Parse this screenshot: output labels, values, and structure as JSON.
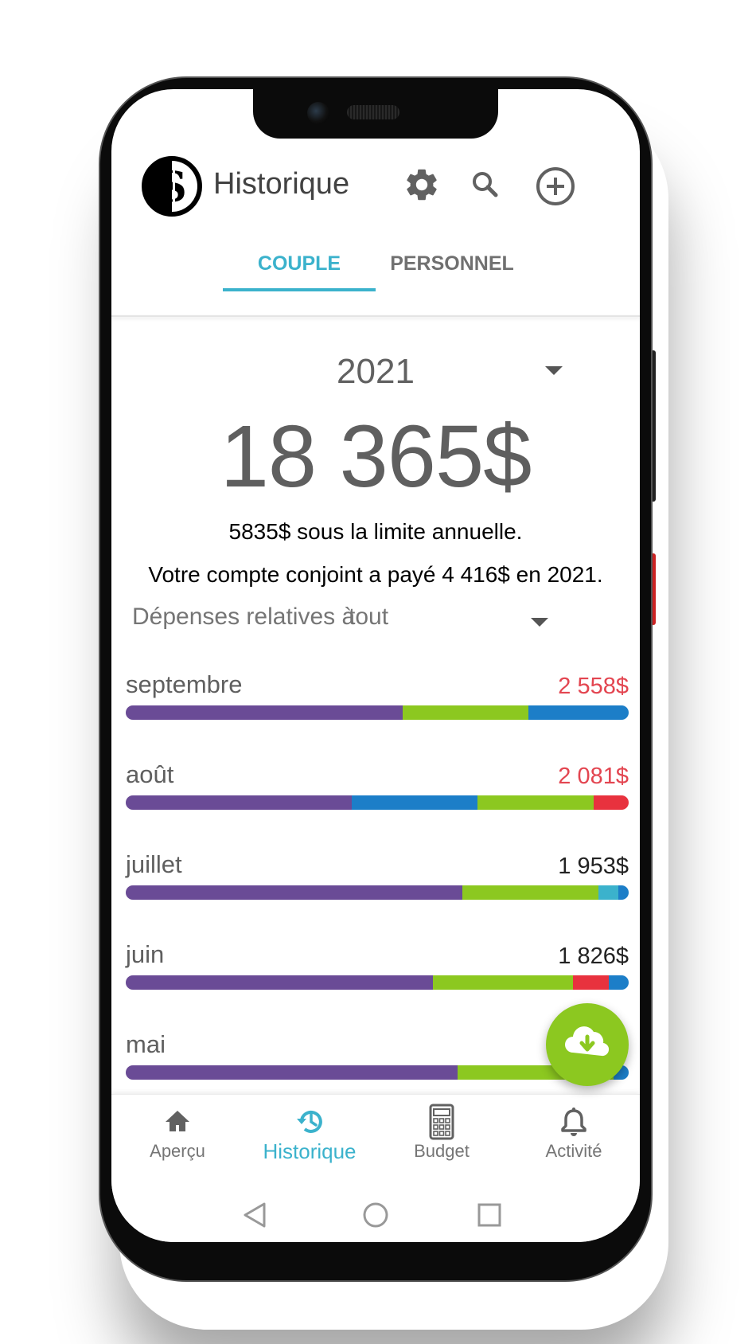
{
  "header": {
    "title": "Historique"
  },
  "tabs": [
    {
      "label": "COUPLE",
      "active": true
    },
    {
      "label": "PERSONNEL",
      "active": false
    }
  ],
  "summary": {
    "year": "2021",
    "total": "18 365$",
    "limit_text": "5835$ sous la limite annuelle.",
    "joint_text": "Votre compte conjoint a payé 4 416$ en 2021."
  },
  "filter": {
    "label": "Dépenses relatives à",
    "value": "tout"
  },
  "colors": {
    "accent": "#3bb2cc",
    "over_budget": "#e34550",
    "fab": "#8cc820",
    "purple": "#6a4b96",
    "green": "#8cc820",
    "blue": "#1c7ec8",
    "red": "#e8323e",
    "cyan": "#3bb2cc"
  },
  "months": [
    {
      "name": "septembre",
      "amount": "2 558$",
      "over": true,
      "segments": [
        {
          "color": "#6a4b96",
          "share": 0.55
        },
        {
          "color": "#8cc820",
          "share": 0.25
        },
        {
          "color": "#1c7ec8",
          "share": 0.2
        }
      ]
    },
    {
      "name": "août",
      "amount": "2 081$",
      "over": true,
      "segments": [
        {
          "color": "#6a4b96",
          "share": 0.45
        },
        {
          "color": "#1c7ec8",
          "share": 0.25
        },
        {
          "color": "#8cc820",
          "share": 0.23
        },
        {
          "color": "#e8323e",
          "share": 0.07
        }
      ]
    },
    {
      "name": "juillet",
      "amount": "1 953$",
      "over": false,
      "segments": [
        {
          "color": "#6a4b96",
          "share": 0.67
        },
        {
          "color": "#8cc820",
          "share": 0.27
        },
        {
          "color": "#3bb2cc",
          "share": 0.04
        },
        {
          "color": "#1c7ec8",
          "share": 0.02
        }
      ]
    },
    {
      "name": "juin",
      "amount": "1 826$",
      "over": false,
      "segments": [
        {
          "color": "#6a4b96",
          "share": 0.61
        },
        {
          "color": "#8cc820",
          "share": 0.28
        },
        {
          "color": "#e8323e",
          "share": 0.07
        },
        {
          "color": "#1c7ec8",
          "share": 0.04
        }
      ]
    },
    {
      "name": "mai",
      "amount": "",
      "over": false,
      "segments": [
        {
          "color": "#6a4b96",
          "share": 0.66
        },
        {
          "color": "#8cc820",
          "share": 0.31
        },
        {
          "color": "#1c7ec8",
          "share": 0.03
        }
      ]
    }
  ],
  "bottom_nav": [
    {
      "label": "Aperçu",
      "icon": "home-icon",
      "active": false
    },
    {
      "label": "Historique",
      "icon": "history-icon",
      "active": true
    },
    {
      "label": "Budget",
      "icon": "calculator-icon",
      "active": false
    },
    {
      "label": "Activité",
      "icon": "bell-icon",
      "active": false
    }
  ],
  "icons": {
    "settings": "gear-icon",
    "search": "search-icon",
    "add": "add-circle-icon",
    "fab": "cloud-download-icon"
  }
}
